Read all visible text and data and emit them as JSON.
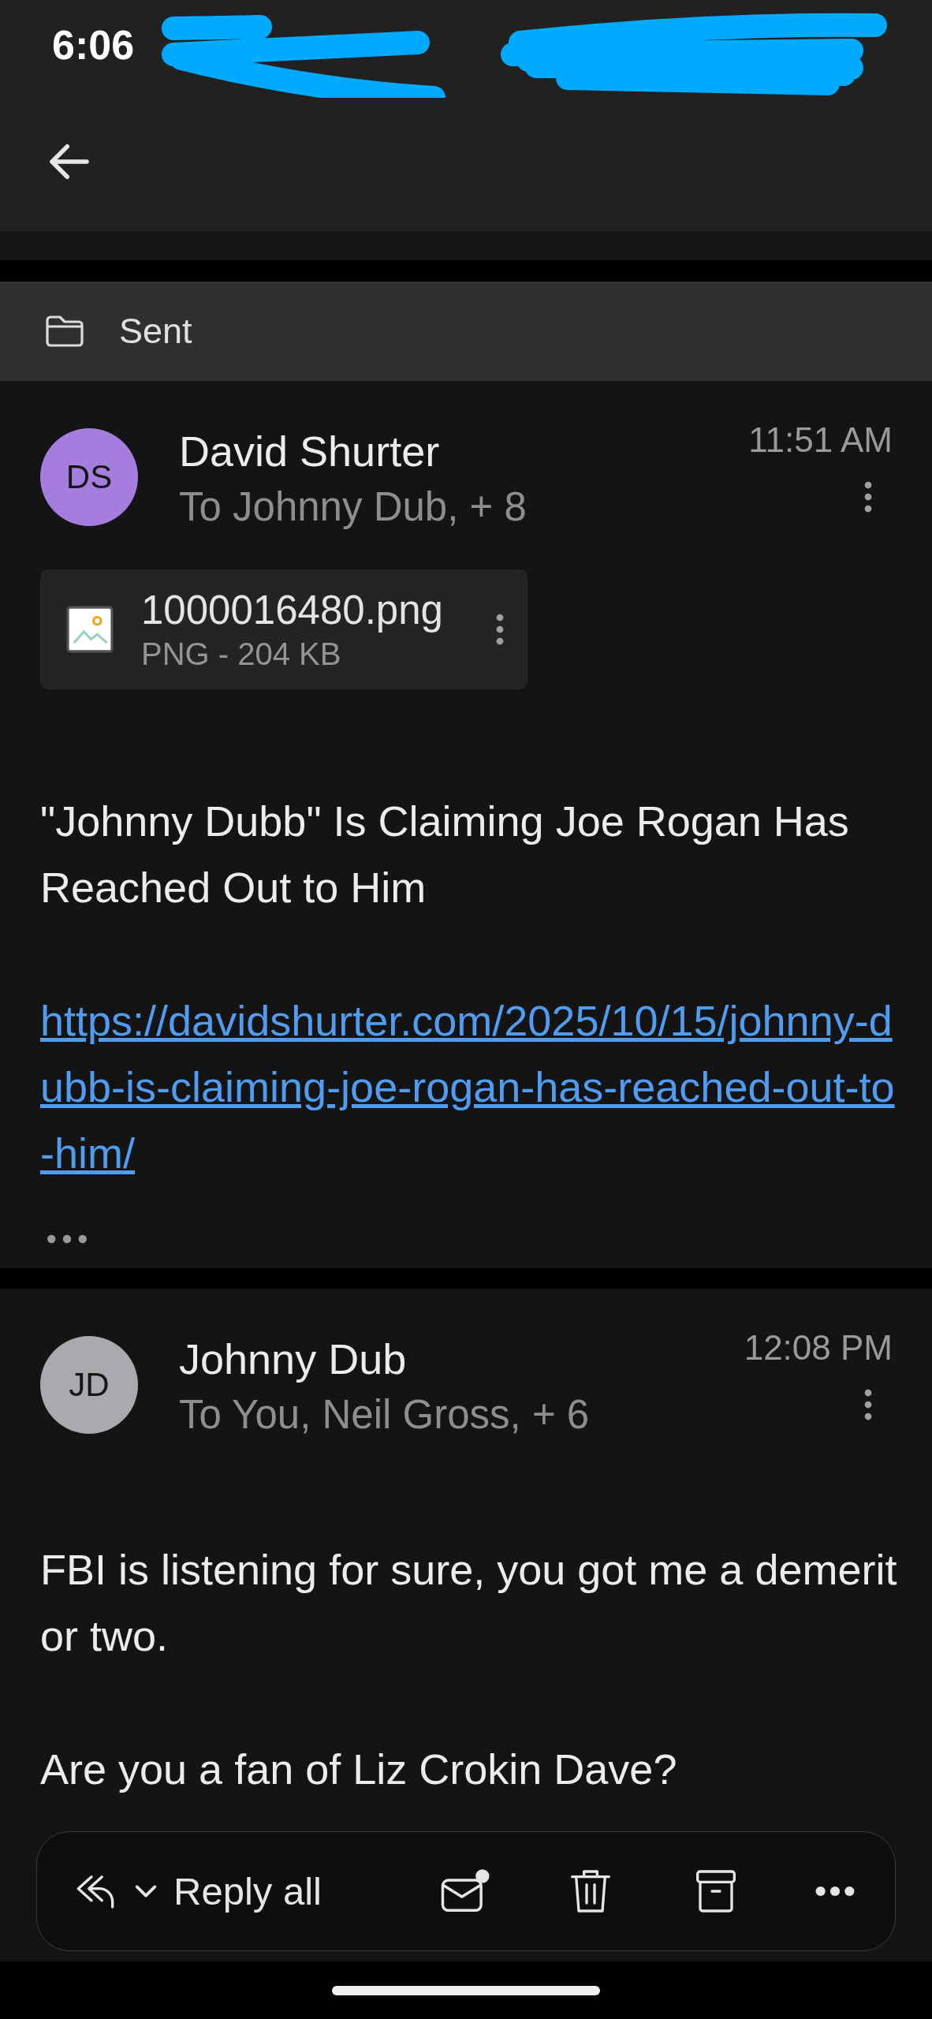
{
  "status_bar": {
    "time": "6:06"
  },
  "folder": {
    "label": "Sent"
  },
  "messages": [
    {
      "initials": "DS",
      "color": "#a57ddf",
      "sender": "David Shurter",
      "recipients": "To Johnny Dub, + 8",
      "time": "11:51 AM",
      "attachments": [
        {
          "name": "1000016480.png",
          "meta": "PNG - 204 KB"
        }
      ],
      "body": [
        {
          "kind": "text",
          "text": "\"Johnny Dubb\" Is Claiming Joe Rogan Has Reached Out to Him"
        },
        {
          "kind": "link",
          "text": "https://davidshurter.com/2025/10/15/johnny-dubb-is-claiming-joe-rogan-has-reached-out-to-him/"
        }
      ],
      "quoted_hidden": true
    },
    {
      "initials": "JD",
      "color": "#a9a9ae",
      "sender": "Johnny Dub",
      "recipients": "To You, Neil Gross, + 6",
      "time": "12:08 PM",
      "body": [
        {
          "kind": "text",
          "text": "FBI is listening for sure, you got me a demerit or two."
        },
        {
          "kind": "text",
          "text": "Are you a fan of Liz Crokin Dave?"
        }
      ]
    }
  ],
  "action_bar": {
    "reply_label": "Reply all"
  }
}
